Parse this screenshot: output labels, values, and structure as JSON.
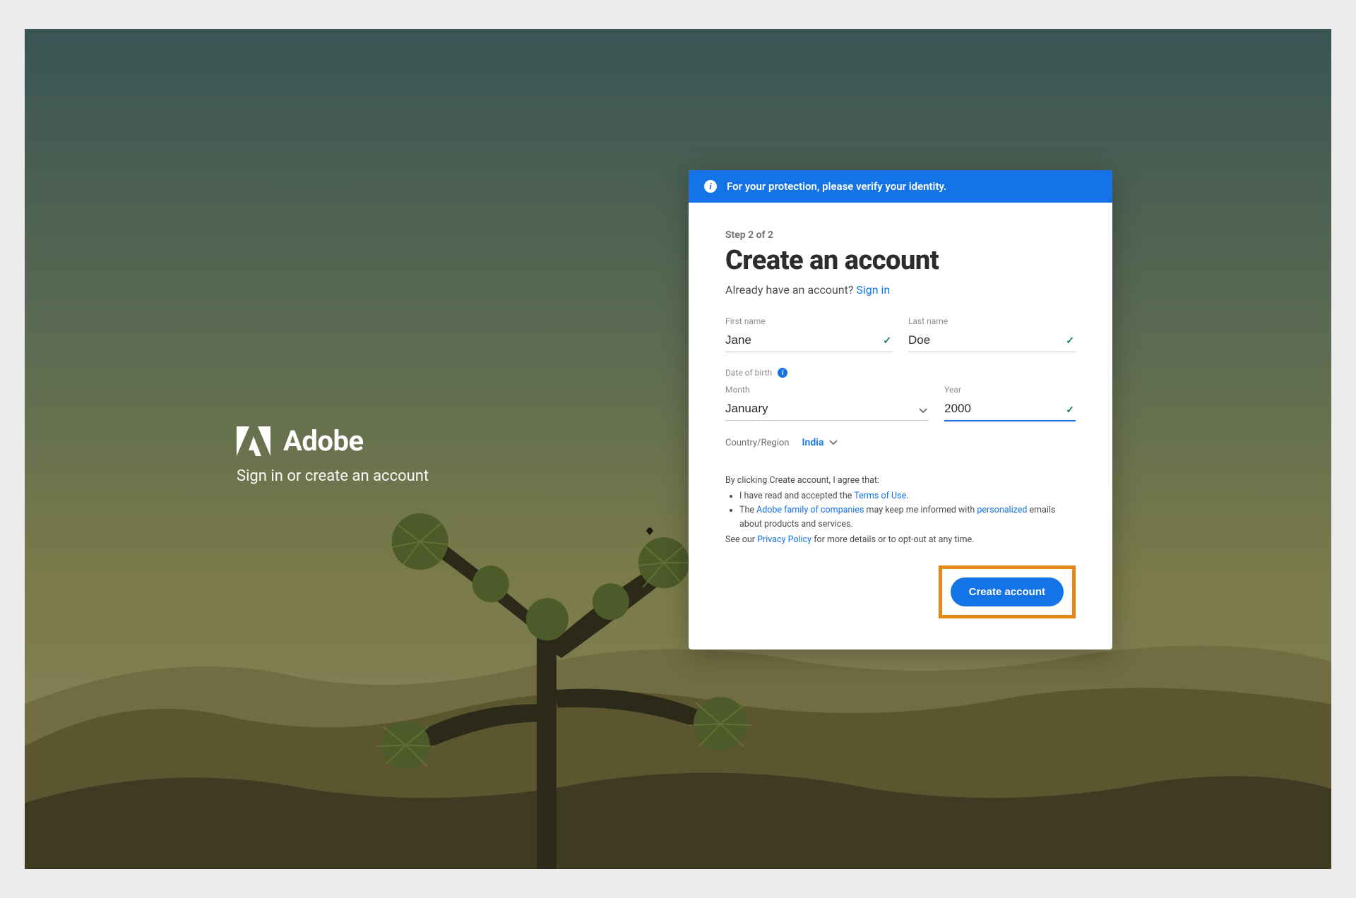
{
  "brand": {
    "name": "Adobe",
    "tagline": "Sign in or create an account"
  },
  "banner": {
    "text": "For your protection, please verify your identity."
  },
  "form": {
    "step_label": "Step 2 of 2",
    "title": "Create an account",
    "already_prefix": "Already have an account? ",
    "sign_in": "Sign in",
    "first_name_label": "First name",
    "first_name_value": "Jane",
    "last_name_label": "Last name",
    "last_name_value": "Doe",
    "dob_label": "Date of birth",
    "month_label": "Month",
    "month_value": "January",
    "year_label": "Year",
    "year_value": "2000",
    "region_label": "Country/Region",
    "region_value": "India"
  },
  "legal": {
    "intro": "By clicking Create account, I agree that:",
    "li1_prefix": "I have read and accepted the ",
    "terms_link": "Terms of Use",
    "li1_suffix": ".",
    "li2_prefix": "The ",
    "family_link": "Adobe family of companies",
    "li2_mid": " may keep me informed with ",
    "personalized_link": "personalized",
    "li2_suffix": " emails about products and services.",
    "outro_prefix": "See our ",
    "privacy_link": "Privacy Policy",
    "outro_suffix": " for more details or to opt-out at any time."
  },
  "actions": {
    "create_label": "Create account"
  }
}
